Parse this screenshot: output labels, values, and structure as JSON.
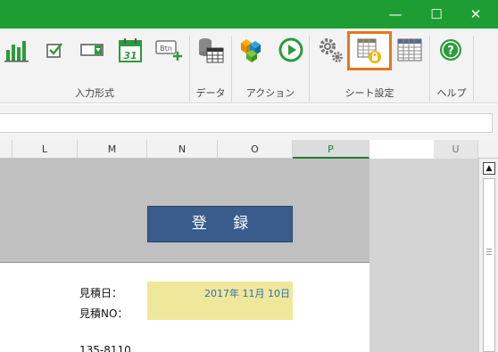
{
  "window": {
    "minimize_glyph": "—",
    "maximize_glyph": "☐",
    "close_glyph": "✕",
    "accent_color": "#1e9e32"
  },
  "ribbon": {
    "groups": [
      {
        "label": "入力形式",
        "buttons": [
          "bar-chart-icon",
          "checkbox-icon",
          "dropdown-icon",
          "calendar-icon",
          "button-control-icon"
        ]
      },
      {
        "label": "データ",
        "buttons": [
          "database-table-icon"
        ]
      },
      {
        "label": "アクション",
        "buttons": [
          "blocks-icon",
          "play-icon"
        ]
      },
      {
        "label": "シート設定",
        "buttons": [
          "settings-gears-icon",
          "sheet-lock-icon",
          "grid-table-icon"
        ],
        "selected": "sheet-lock-icon"
      },
      {
        "label": "ヘルプ",
        "buttons": [
          "help-icon"
        ]
      }
    ],
    "calendar_day": "31",
    "button_control_text": "Btn",
    "help_glyph": "?"
  },
  "formula_bar": {
    "value": ""
  },
  "columns": [
    "L",
    "M",
    "N",
    "O",
    "P",
    "U"
  ],
  "active_column": "P",
  "sheet": {
    "register_button": "登 録",
    "estimate_date_label": "見積日：",
    "estimate_no_label": "見積NO：",
    "estimate_date_value": "2017年 11月 10日",
    "postal_code": "135-8110"
  },
  "scrollbar": {
    "up_glyph": "▲"
  }
}
